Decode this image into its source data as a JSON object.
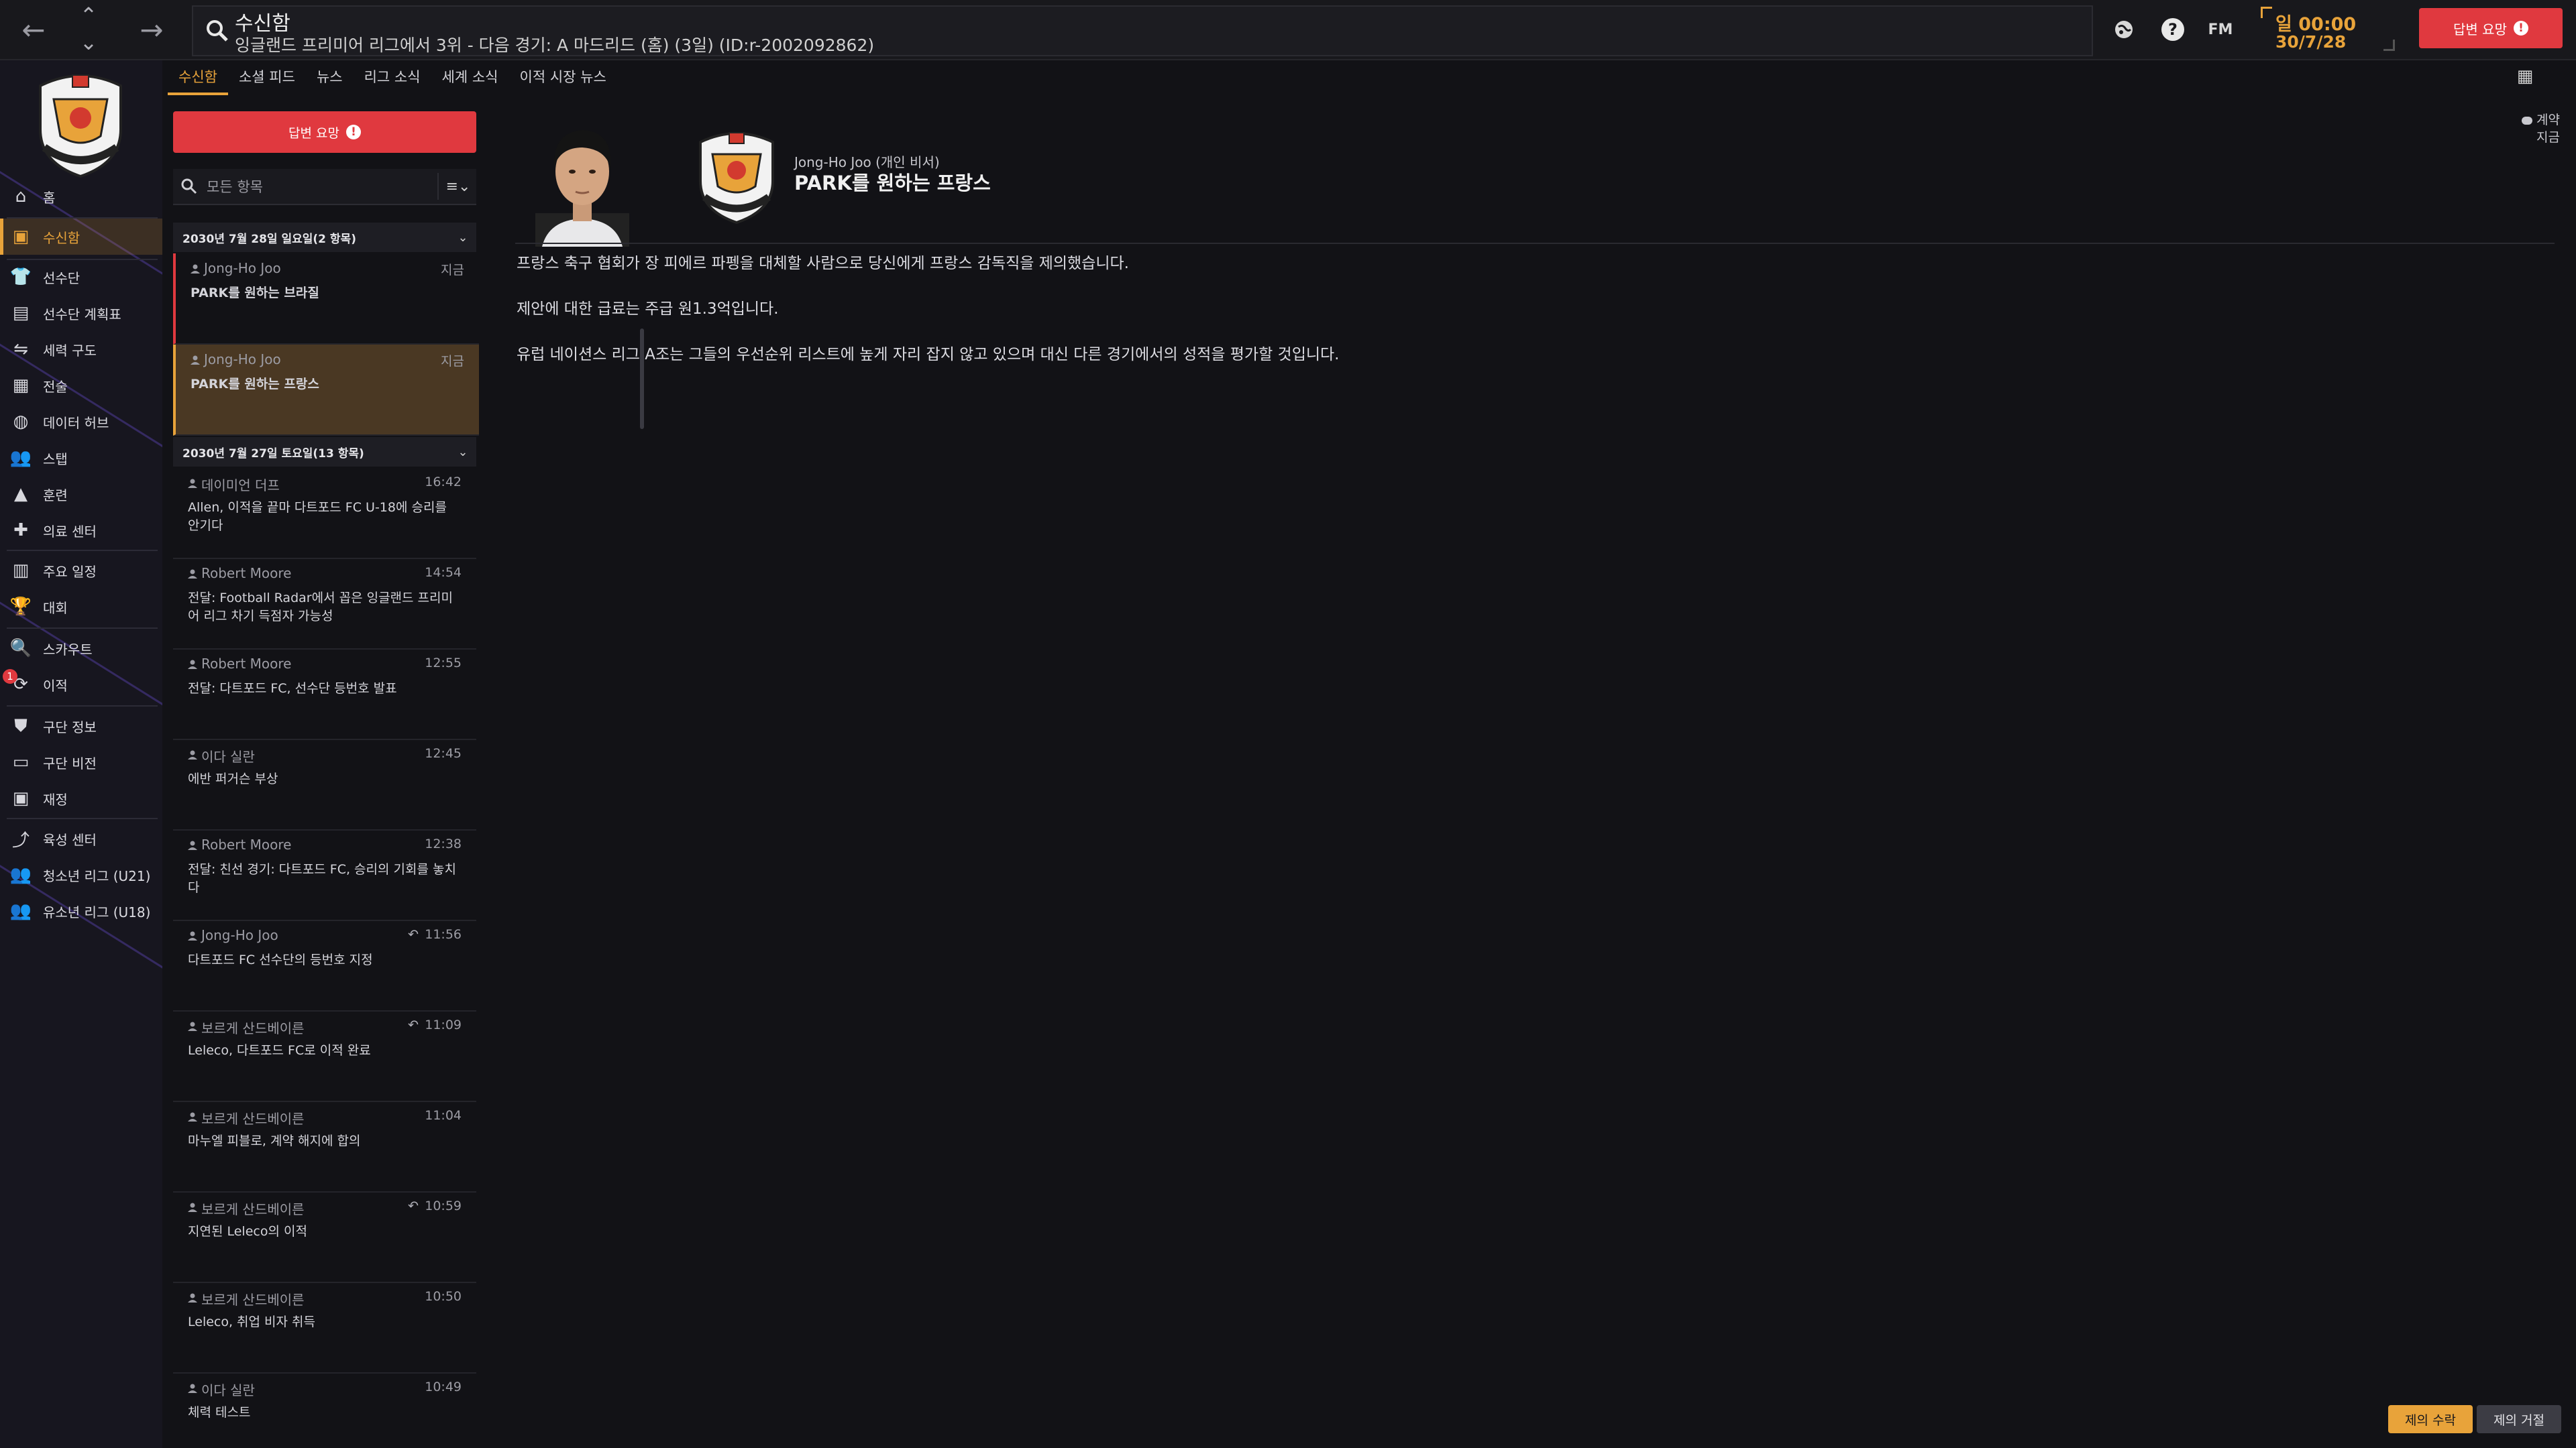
{
  "header": {
    "title": "수신함",
    "subtitle": "잉글랜드 프리미어 리그에서 3위 - 다음 경기: A 마드리드 (홈) (3일) (ID:r-2002092862)",
    "fm_label": "FM",
    "day_time": "일 00:00",
    "date": "30/7/28",
    "respond_label": "답변 요망"
  },
  "sidebar": {
    "items": [
      {
        "label": "홈",
        "icon": "home-icon"
      },
      {
        "label": "수신함",
        "icon": "inbox-icon"
      },
      {
        "label": "선수단",
        "icon": "shirt-icon"
      },
      {
        "label": "선수단 계획표",
        "icon": "clipboard-icon"
      },
      {
        "label": "세력 구도",
        "icon": "dynamics-icon"
      },
      {
        "label": "전술",
        "icon": "tactics-icon"
      },
      {
        "label": "데이터 허브",
        "icon": "data-hub-icon"
      },
      {
        "label": "스탭",
        "icon": "staff-icon"
      },
      {
        "label": "훈련",
        "icon": "training-icon"
      },
      {
        "label": "의료 센터",
        "icon": "medical-icon"
      },
      {
        "label": "주요 일정",
        "icon": "calendar-icon"
      },
      {
        "label": "대회",
        "icon": "trophy-icon"
      },
      {
        "label": "스카우트",
        "icon": "scouting-icon"
      },
      {
        "label": "이적",
        "icon": "transfers-icon",
        "badge": "1"
      },
      {
        "label": "구단 정보",
        "icon": "club-shield-icon"
      },
      {
        "label": "구단 비전",
        "icon": "vision-icon"
      },
      {
        "label": "재정",
        "icon": "finances-icon"
      },
      {
        "label": "육성 센터",
        "icon": "development-icon"
      },
      {
        "label": "청소년 리그 (U21)",
        "icon": "u21-icon"
      },
      {
        "label": "유소년 리그 (U18)",
        "icon": "u18-icon"
      }
    ]
  },
  "tabs": [
    "수신함",
    "소셜 피드",
    "뉴스",
    "리그 소식",
    "세계 소식",
    "이적 시장 뉴스"
  ],
  "list": {
    "respond_label": "답변 요망",
    "filter_placeholder": "모든 항목",
    "groups": [
      {
        "header": "2030년 7월 28일 일요일(2 항목)",
        "messages": [
          {
            "sender": "Jong-Ho Joo",
            "time": "지금",
            "subject": "PARK를 원하는 브라질",
            "state": "unread"
          },
          {
            "sender": "Jong-Ho Joo",
            "time": "지금",
            "subject": "PARK를 원하는 프랑스",
            "state": "selected"
          }
        ]
      },
      {
        "header": "2030년 7월 27일 토요일(13 항목)",
        "messages": [
          {
            "sender": "데이미언 더프",
            "time": "16:42",
            "subject": "Allen, 이적을 끝마 다트포드 FC U-18에 승리를 안기다"
          },
          {
            "sender": "Robert Moore",
            "time": "14:54",
            "subject": "전달: Football Radar에서 꼽은 잉글랜드 프리미어 리그 차기 득점자 가능성"
          },
          {
            "sender": "Robert Moore",
            "time": "12:55",
            "subject": "전달: 다트포드 FC, 선수단 등번호 발표"
          },
          {
            "sender": "이다 실란",
            "time": "12:45",
            "subject": "에반 퍼거슨 부상"
          },
          {
            "sender": "Robert Moore",
            "time": "12:38",
            "subject": "전달: 친선 경기: 다트포드 FC, 승리의 기회를 놓치다"
          },
          {
            "sender": "Jong-Ho Joo",
            "time": "11:56",
            "reply": "↶",
            "subject": "다트포드 FC 선수단의 등번호 지정"
          },
          {
            "sender": "보르게 산드베이른",
            "time": "11:09",
            "reply": "↶",
            "subject": "Leleco, 다트포드 FC로 이적 완료"
          },
          {
            "sender": "보르게 산드베이른",
            "time": "11:04",
            "subject": "마누엘 피블로, 계약 해지에 합의"
          },
          {
            "sender": "보르게 산드베이른",
            "time": "10:59",
            "reply": "↶",
            "subject": "지연된 Leleco의 이적"
          },
          {
            "sender": "보르게 산드베이른",
            "time": "10:50",
            "subject": "Leleco, 취업 비자 취득"
          },
          {
            "sender": "이다 실란",
            "time": "10:49",
            "subject": "체력 테스트"
          }
        ]
      }
    ]
  },
  "reader": {
    "from": "Jong-Ho Joo (개인 비서)",
    "title": "PARK를 원하는 프랑스",
    "contract_tag_1": "계약",
    "contract_tag_2": "지금",
    "paragraphs": [
      "프랑스 축구 협회가 장 피에르 파펭을 대체할 사람으로 당신에게 프랑스 감독직을 제의했습니다.",
      "제안에 대한 급료는 주급 원1.3억입니다.",
      "유럽 네이션스 리그 A조는 그들의 우선순위 리스트에 높게 자리 잡지 않고 있으며 대신 다른 경기에서의 성적을 평가할 것입니다."
    ],
    "accept_label": "제의 수락",
    "reject_label": "제의 거절"
  },
  "colors": {
    "accent": "#e8a33a",
    "danger": "#e0393f",
    "background": "#121216",
    "sidebar": "#17161f"
  }
}
